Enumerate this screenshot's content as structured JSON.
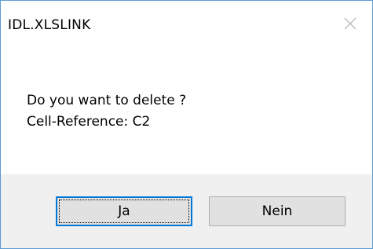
{
  "dialog": {
    "title": "IDL.XLSLINK",
    "close_icon": "close-icon",
    "message_line1": "Do you want to delete ?",
    "message_line2": "Cell-Reference: C2",
    "buttons": {
      "ja_label": "Ja",
      "nein_label": "Nein"
    }
  },
  "colors": {
    "border": "#5b9bd5",
    "footer_bg": "#f0f0f0",
    "button_bg": "#e1e1e1",
    "focus": "#0078d7"
  }
}
